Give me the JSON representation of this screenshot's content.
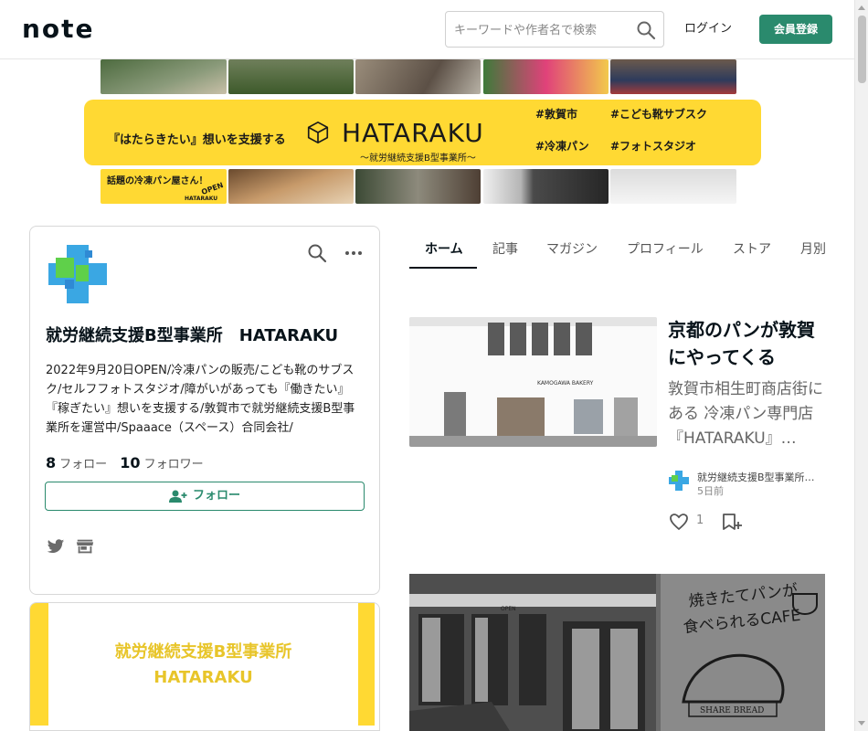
{
  "header": {
    "logo_text": "note",
    "search_placeholder": "キーワードや作者名で検索",
    "login_label": "ログイン",
    "signup_label": "会員登録"
  },
  "banner": {
    "headline": "『はたらきたい』想いを支援する",
    "brand": "HATARAKU",
    "subtitle": "～就労継続支援B型事業所～",
    "tags": [
      "#敦賀市",
      "#こども靴サブスク",
      "#冷凍パン",
      "#フォトスタジオ"
    ],
    "promo": "話題の冷凍パン屋さん！",
    "open_label": "OPEN",
    "promo_brand": "HATARAKU"
  },
  "profile": {
    "name": "就労継続支援B型事業所　HATARAKU",
    "description": "2022年9月20日OPEN/冷凍パンの販売/こども靴のサブスク/セルフフォトスタジオ/障がいがあっても『働きたい』『稼ぎたい』想いを支援する/敦賀市で就労継続支援B型事業所を運営中/Spaaace（スペース）合同会社/",
    "following_count": "8",
    "following_label": "フォロー",
    "followers_count": "10",
    "followers_label": "フォロワー",
    "follow_button": "フォロー"
  },
  "magazine": {
    "line1": "就労継続支援B型事業所",
    "line2": "HATARAKU"
  },
  "tabs": [
    {
      "label": "ホーム",
      "active": true
    },
    {
      "label": "記事",
      "active": false
    },
    {
      "label": "マガジン",
      "active": false
    },
    {
      "label": "プロフィール",
      "active": false
    },
    {
      "label": "ストア",
      "active": false
    },
    {
      "label": "月別",
      "active": false
    }
  ],
  "articles": [
    {
      "title": "京都のパンが敦賀にやってくる",
      "excerpt": "敦賀市相生町商店街にある 冷凍パン専門店『HATARAKU』…",
      "image_sign": "KAMOGAWA BAKERY",
      "creator": "就労継続支援B型事業所…",
      "date": "5日前",
      "likes": "1"
    },
    {
      "image_text_line1": "焼きたてパンが",
      "image_text_line2": "食べられるCAFE",
      "image_sign": "SHARE BREAD",
      "open_label": "OPEN"
    }
  ],
  "colors": {
    "accent": "#2a8a6d",
    "banner_yellow": "#ffd933"
  }
}
